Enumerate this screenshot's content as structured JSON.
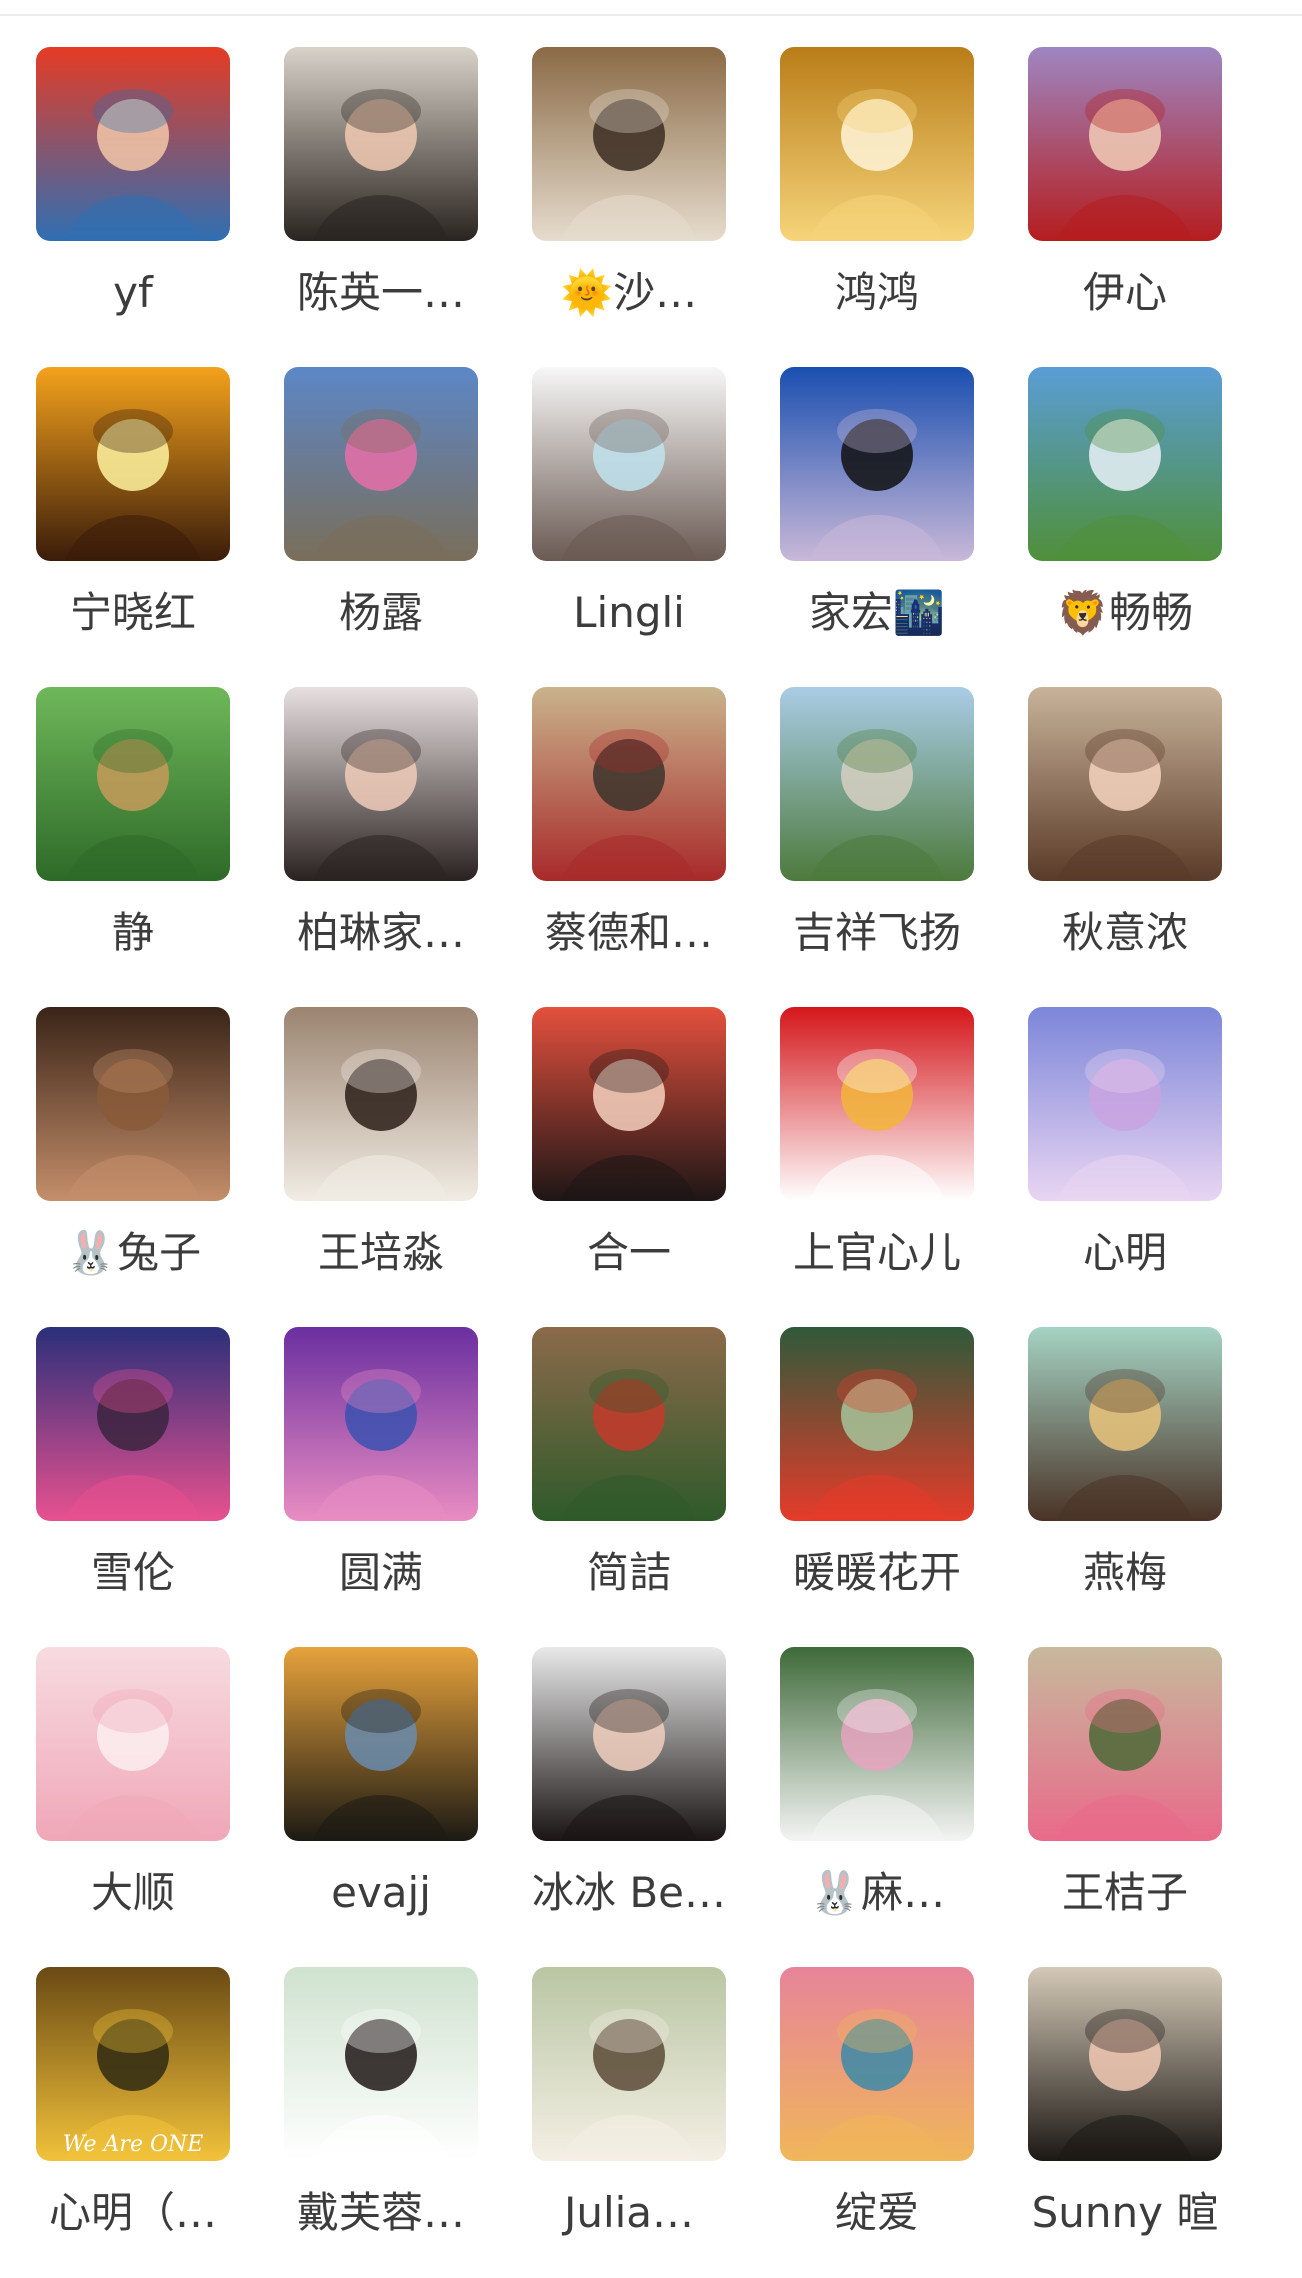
{
  "members": [
    {
      "name": "yf",
      "avatar": "woman-in-denim-red-background",
      "colors": [
        "#e53b24",
        "#2f6fb3",
        "#f3c7a8"
      ]
    },
    {
      "name": "陈英一…",
      "avatar": "woman-selfie-indoor",
      "colors": [
        "#d9d2c9",
        "#2a2420",
        "#f0c9b2"
      ]
    },
    {
      "name": "🌞沙…",
      "avatar": "woman-with-sunglasses-and-dog",
      "colors": [
        "#8a6a46",
        "#e6dccd",
        "#3b2d22"
      ]
    },
    {
      "name": "鸿鸿",
      "avatar": "diamond-gold-swirl",
      "colors": [
        "#b97d18",
        "#f6d47a",
        "#fff5d8"
      ]
    },
    {
      "name": "伊心",
      "avatar": "woman-red-top-purple-background",
      "colors": [
        "#9e86c2",
        "#b51d1f",
        "#f1cdb6"
      ]
    },
    {
      "name": "宁晓红",
      "avatar": "silhouette-sunset-orange",
      "colors": [
        "#f4a21c",
        "#3a1c0a",
        "#fff3a0"
      ]
    },
    {
      "name": "杨露",
      "avatar": "woman-riding-horse-mountains",
      "colors": [
        "#5c87c7",
        "#7a6e5a",
        "#e86fa8"
      ]
    },
    {
      "name": "Lingli",
      "avatar": "cartoon-girl-face",
      "colors": [
        "#f7f7f7",
        "#6a5a52",
        "#bfe3ee"
      ]
    },
    {
      "name": "家宏🌃",
      "avatar": "sea-sunset-painting",
      "colors": [
        "#1a4fb0",
        "#c9b8d8",
        "#111111"
      ]
    },
    {
      "name": "🦁畅畅",
      "avatar": "grassland-blue-sky",
      "colors": [
        "#5a9dd6",
        "#4f8f3a",
        "#e9f1f8"
      ]
    },
    {
      "name": "静",
      "avatar": "cartoon-girl-swing-garden",
      "colors": [
        "#6fb85a",
        "#2d6a28",
        "#c79a5a"
      ]
    },
    {
      "name": "柏琳家…",
      "avatar": "woman-selfie-white",
      "colors": [
        "#e8dfe0",
        "#2a2220",
        "#f0cbb8"
      ]
    },
    {
      "name": "蔡德和…",
      "avatar": "two-kids-sitting",
      "colors": [
        "#c9b38c",
        "#a82a2a",
        "#3b342c"
      ]
    },
    {
      "name": "吉祥飞扬",
      "avatar": "city-lake-reflection",
      "colors": [
        "#a9cce6",
        "#4d7a3c",
        "#d6d0c2"
      ]
    },
    {
      "name": "秋意浓",
      "avatar": "cartoon-child-smiling",
      "colors": [
        "#c8b39a",
        "#5a3a28",
        "#f4d4be"
      ]
    },
    {
      "name": "🐰兔子",
      "avatar": "cartoon-boy-fur-coat",
      "colors": [
        "#3a2418",
        "#c48e6a",
        "#8a5a3a"
      ]
    },
    {
      "name": "王培淼",
      "avatar": "woman-white-qipao",
      "colors": [
        "#9b8470",
        "#f1ece4",
        "#2a1e18"
      ]
    },
    {
      "name": "合一",
      "avatar": "illustrated-woman-portrait",
      "colors": [
        "#e4503d",
        "#1d1616",
        "#f6d1c0"
      ]
    },
    {
      "name": "上官心儿",
      "avatar": "lucky-cat-red",
      "colors": [
        "#d4161b",
        "#ffffff",
        "#f2b53a"
      ]
    },
    {
      "name": "心明",
      "avatar": "fantasy-woman-crystal-ball",
      "colors": [
        "#7c86d9",
        "#e9d5f2",
        "#c9a3e0"
      ]
    },
    {
      "name": "雪伦",
      "avatar": "anime-girl-neon-city",
      "colors": [
        "#2b2f7a",
        "#e8518f",
        "#3b2340"
      ]
    },
    {
      "name": "圆满",
      "avatar": "purple-mandala",
      "colors": [
        "#6a2fa0",
        "#e98cc2",
        "#3b51b0"
      ]
    },
    {
      "name": "简詰",
      "avatar": "christmas-tree-room",
      "colors": [
        "#8b6a4a",
        "#2f5a2a",
        "#c43a2a"
      ]
    },
    {
      "name": "暖暖花开",
      "avatar": "red-flower-branch",
      "colors": [
        "#2f5a3a",
        "#e63b2a",
        "#a6c49a"
      ]
    },
    {
      "name": "燕梅",
      "avatar": "illustrated-woman-short-hair",
      "colors": [
        "#a5d3c4",
        "#4a3326",
        "#e9c37a"
      ]
    },
    {
      "name": "大顺",
      "avatar": "pink-pig-cartoon",
      "colors": [
        "#f7dbe0",
        "#f0a7b8",
        "#fbeef0"
      ]
    },
    {
      "name": "evajj",
      "avatar": "tree-silhouette-dusk",
      "colors": [
        "#e7a23c",
        "#1c1a14",
        "#6a8cae"
      ]
    },
    {
      "name": "冰冰 Be…",
      "avatar": "woman-glasses-portrait",
      "colors": [
        "#e9e9e9",
        "#1a1414",
        "#f0cfbd"
      ]
    },
    {
      "name": "🐰麻…",
      "avatar": "white-rabbits-peonies",
      "colors": [
        "#3f6a3a",
        "#f4f4f4",
        "#e6a3c0"
      ]
    },
    {
      "name": "王桔子",
      "avatar": "woman-pink-top-garden",
      "colors": [
        "#c7b99c",
        "#e96a8a",
        "#4c6a36"
      ]
    },
    {
      "name": "心明（…",
      "avatar": "sunlit-forest-we-are-one",
      "colors": [
        "#6a4a14",
        "#f2c23a",
        "#2f2a12"
      ],
      "caption": "We Are ONE"
    },
    {
      "name": "戴芙蓉…",
      "avatar": "woman-white-shirt-green",
      "colors": [
        "#cfe2cf",
        "#ffffff",
        "#1e1616"
      ]
    },
    {
      "name": "Julia…",
      "avatar": "woman-meditating-light",
      "colors": [
        "#b9c6a3",
        "#f4efe4",
        "#5a4a36"
      ]
    },
    {
      "name": "绽爱",
      "avatar": "sunset-sea-painting",
      "colors": [
        "#e7849a",
        "#f0b65a",
        "#3b8aa8"
      ]
    },
    {
      "name": "Sunny 暄",
      "avatar": "smiling-woman-bob-hair",
      "colors": [
        "#d4c9b7",
        "#1c1814",
        "#f1c9b3"
      ]
    }
  ]
}
